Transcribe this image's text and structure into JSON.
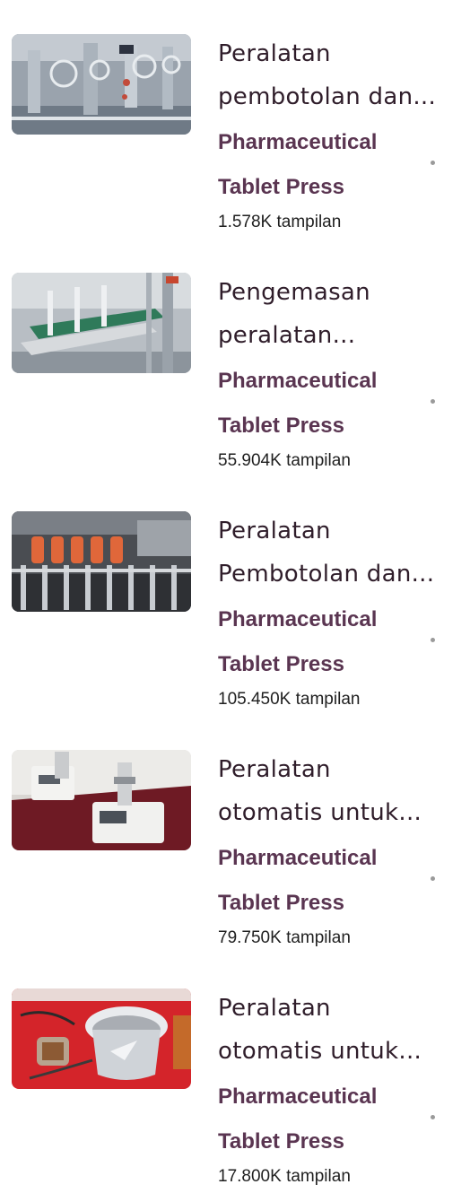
{
  "items": [
    {
      "title_line1": "Peralatan",
      "title_line2": "pembotolan dan...",
      "category_line1": "Pharmaceutical",
      "category_line2": "Tablet Press",
      "views": "1.578K tampilan",
      "image": "bottling-machine-image"
    },
    {
      "title_line1": "Pengemasan",
      "title_line2": "peralatan...",
      "category_line1": "Pharmaceutical",
      "category_line2": "Tablet Press",
      "views": "55.904K tampilan",
      "image": "packaging-line-image"
    },
    {
      "title_line1": "Peralatan",
      "title_line2": "Pembotolan dan...",
      "category_line1": "Pharmaceutical",
      "category_line2": "Tablet Press",
      "views": "105.450K tampilan",
      "image": "bottle-filling-image"
    },
    {
      "title_line1": "Peralatan",
      "title_line2": "otomatis untuk...",
      "category_line1": "Pharmaceutical",
      "category_line2": "Tablet Press",
      "views": "79.750K tampilan",
      "image": "tablet-tester-image"
    },
    {
      "title_line1": "Peralatan",
      "title_line2": "otomatis untuk...",
      "category_line1": "Pharmaceutical",
      "category_line2": "Tablet Press",
      "views": "17.800K tampilan",
      "image": "grinder-machine-image"
    }
  ],
  "colors": {
    "title": "#2f1d2a",
    "category": "#5a3551",
    "views": "#1f1f1f",
    "dot": "#9a9a9a"
  }
}
